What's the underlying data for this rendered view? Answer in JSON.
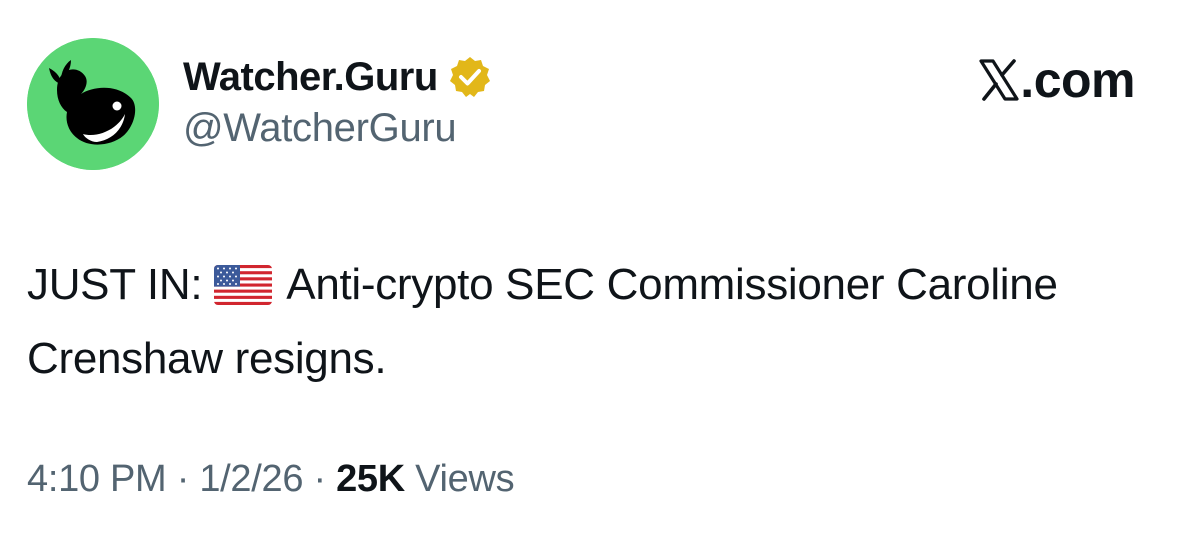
{
  "author": {
    "display_name": "Watcher.Guru",
    "handle": "@WatcherGuru",
    "verified": true,
    "avatar_icon": "whale-logo-icon",
    "avatar_color": "#5bd675"
  },
  "brand": {
    "logo_icon": "x-logo-icon",
    "text": ".com"
  },
  "tweet": {
    "text_before_flag": "JUST IN:",
    "flag_icon": "us-flag-icon",
    "text_after_flag": "Anti-crypto SEC Commissioner Caroline Crenshaw resigns."
  },
  "meta": {
    "time": "4:10 PM",
    "date": "1/2/26",
    "separator": "·",
    "views_count": "25K",
    "views_label": "Views"
  },
  "colors": {
    "text_primary": "#0f1419",
    "text_secondary": "#536471",
    "verified_badge": "#e2b719"
  }
}
